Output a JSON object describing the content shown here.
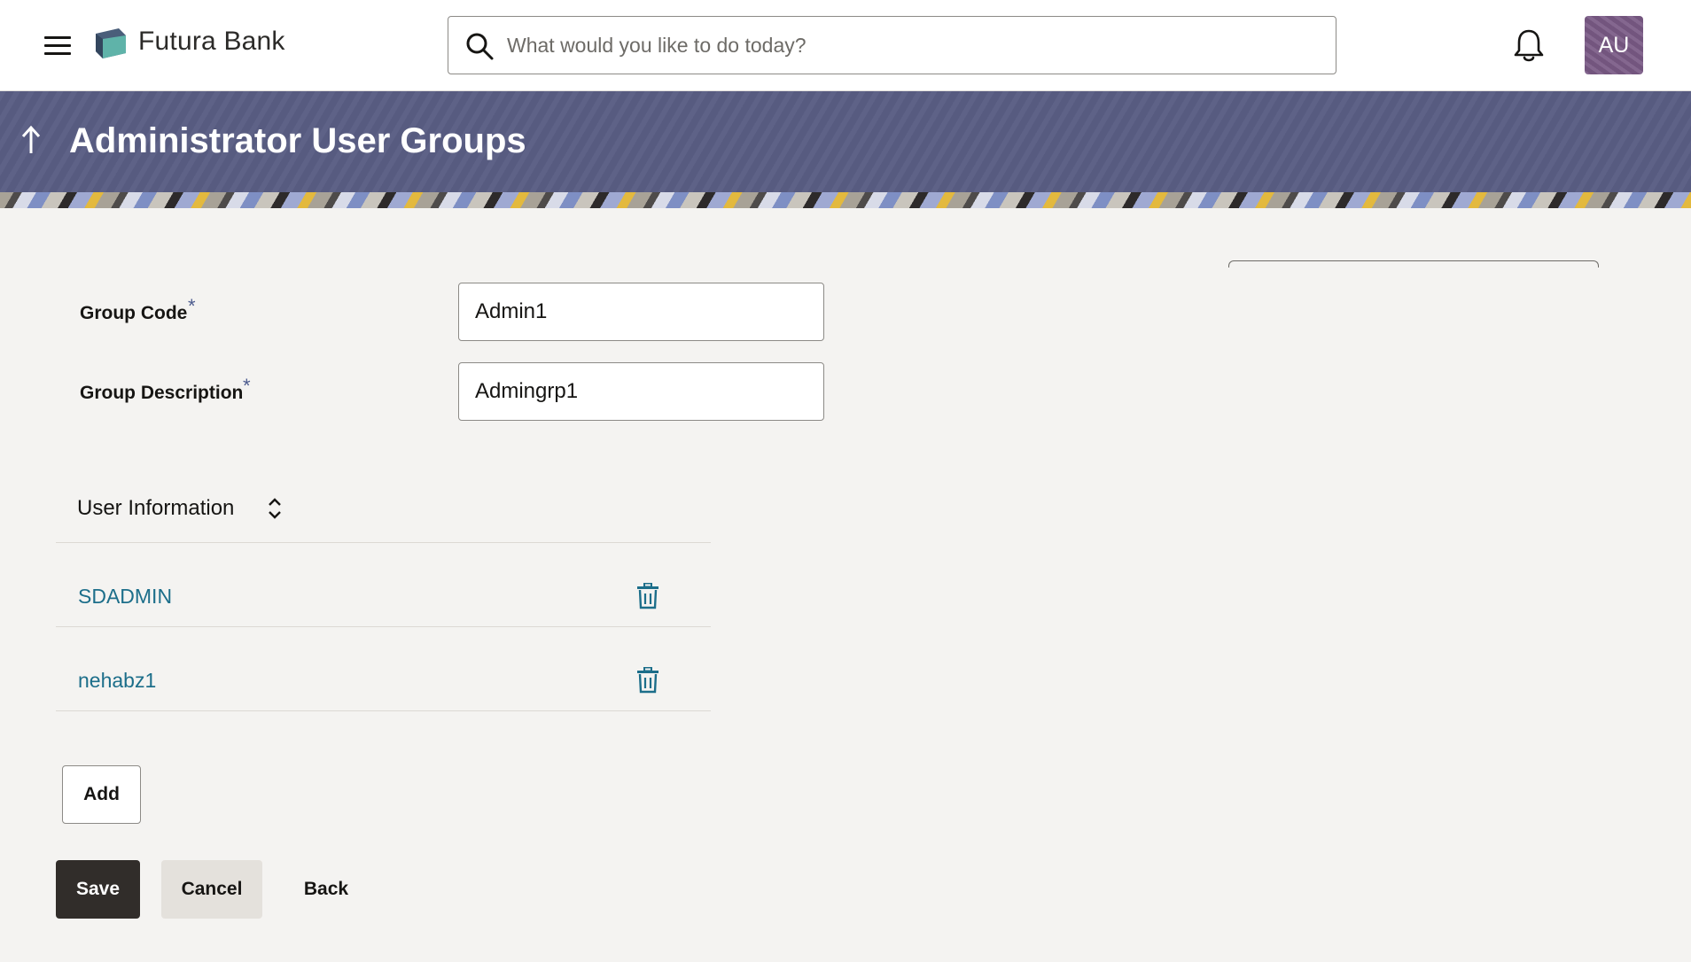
{
  "header": {
    "brand_name": "Futura Bank",
    "search_placeholder": "What would you like to do today?",
    "avatar_initials": "AU"
  },
  "banner": {
    "title": "Administrator User Groups"
  },
  "form": {
    "group_code_label": "Group Code",
    "group_code_value": "Admin1",
    "group_description_label": "Group Description",
    "group_description_value": "Admingrp1",
    "required_marker": "*"
  },
  "user_information": {
    "title": "User Information",
    "users": [
      {
        "name": "SDADMIN"
      },
      {
        "name": "nehabz1"
      }
    ]
  },
  "actions": {
    "add_label": "Add",
    "save_label": "Save",
    "cancel_label": "Cancel",
    "back_label": "Back"
  },
  "colors": {
    "banner_bg": "#5a5e84",
    "link": "#1c6e8a",
    "primary_button": "#312d2a",
    "avatar_bg": "#7a5a86"
  },
  "icons": [
    "hamburger-menu-icon",
    "bank-logo-icon",
    "search-icon",
    "bell-icon",
    "up-arrow-icon",
    "sort-icon",
    "trash-icon"
  ]
}
